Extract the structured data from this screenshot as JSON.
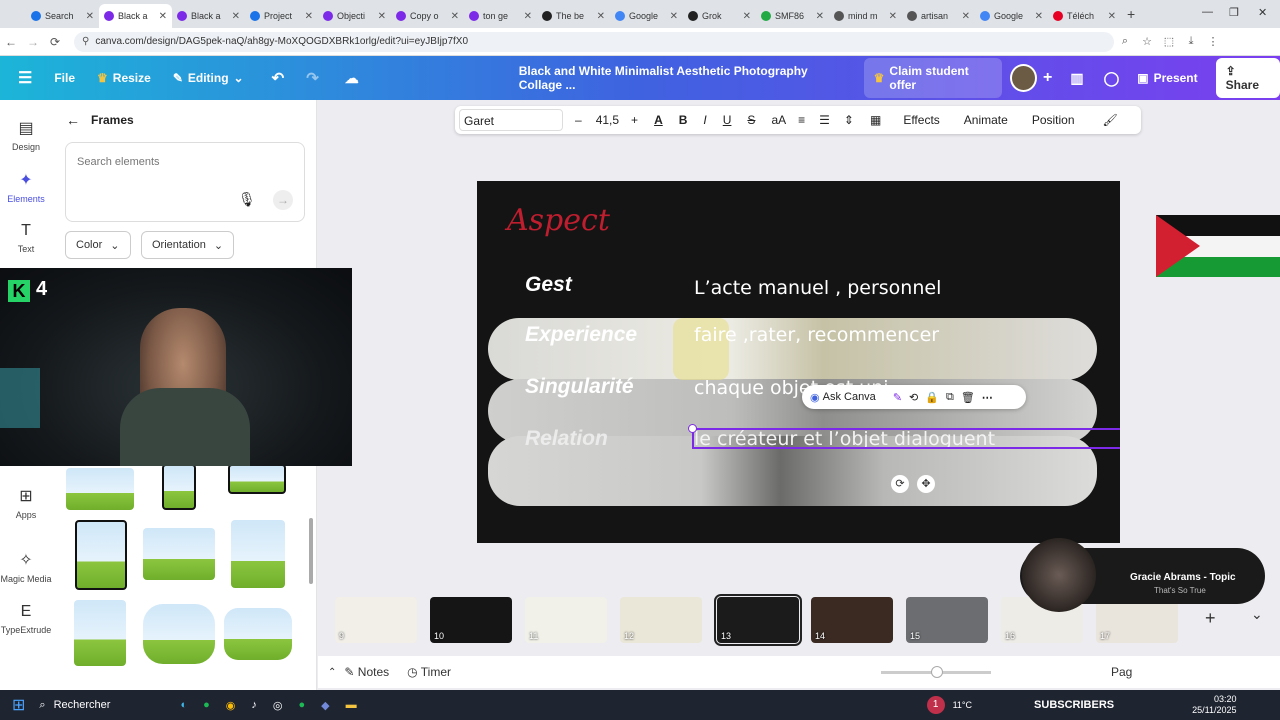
{
  "browser": {
    "tabs": [
      {
        "title": "Search",
        "color": "#1a73e8",
        "active": false
      },
      {
        "title": "Black a",
        "color": "#7d2ae8",
        "active": true
      },
      {
        "title": "Black a",
        "color": "#7d2ae8",
        "active": false
      },
      {
        "title": "Project",
        "color": "#1a73e8",
        "active": false
      },
      {
        "title": "Objecti",
        "color": "#7d2ae8",
        "active": false
      },
      {
        "title": "Copy o",
        "color": "#7d2ae8",
        "active": false
      },
      {
        "title": "ton ge",
        "color": "#7d2ae8",
        "active": false
      },
      {
        "title": "The be",
        "color": "#222222",
        "active": false
      },
      {
        "title": "Google",
        "color": "#4285f4",
        "active": false
      },
      {
        "title": "Grok",
        "color": "#222222",
        "active": false
      },
      {
        "title": "SMF86",
        "color": "#22aa44",
        "active": false
      },
      {
        "title": "mind m",
        "color": "#555555",
        "active": false
      },
      {
        "title": "artisan",
        "color": "#555555",
        "active": false
      },
      {
        "title": "Google",
        "color": "#4285f4",
        "active": false
      },
      {
        "title": "Téléch",
        "color": "#e60023",
        "active": false
      }
    ],
    "url": "canva.com/design/DAG5pek-naQ/ah8gy-MoXQOGDXBRk1orlg/edit?ui=eyJBIjp7fX0"
  },
  "header": {
    "file": "File",
    "resize": "Resize",
    "editing": "Editing",
    "doc_title": "Black and White Minimalist Aesthetic Photography Collage ...",
    "claim": "Claim student offer",
    "present": "Present",
    "share": "Share"
  },
  "rail": {
    "design": "Design",
    "elements": "Elements",
    "text": "Text",
    "apps": "Apps",
    "magic": "Magic Media",
    "typeextrude": "TypeExtrude"
  },
  "panel": {
    "back_title": "Frames",
    "search_placeholder": "Search elements",
    "color": "Color",
    "orientation": "Orientation"
  },
  "toolbar": {
    "font": "Garet",
    "size": "41,5",
    "effects": "Effects",
    "animate": "Animate",
    "position": "Position"
  },
  "slide": {
    "title": "Aspect",
    "rows": [
      {
        "label": "Gest",
        "value": "L’acte manuel , personnel"
      },
      {
        "label": "Experience",
        "value": "faire ,rater, recommencer"
      },
      {
        "label": "Singularité",
        "value": "chaque objet est uni"
      },
      {
        "label": "Relation",
        "value": "le créateur et l’objet dialoguent"
      }
    ]
  },
  "context_menu": {
    "ask": "Ask Canva"
  },
  "thumbnails": [
    {
      "num": "9"
    },
    {
      "num": "10"
    },
    {
      "num": "11"
    },
    {
      "num": "12"
    },
    {
      "num": "13"
    },
    {
      "num": "14"
    },
    {
      "num": "15"
    },
    {
      "num": "16"
    },
    {
      "num": "17"
    }
  ],
  "bottom": {
    "notes": "Notes",
    "timer": "Timer",
    "pages": "Pag"
  },
  "webcam": {
    "badge": "4"
  },
  "music": {
    "artist": "Gracie Abrams - Topic",
    "song": "That's So True"
  },
  "taskbar": {
    "search": "Rechercher",
    "subscribers": "SUBSCRIBERS",
    "badge": "1",
    "temp": "11°C",
    "time": "03:20",
    "date": "25/11/2025"
  }
}
